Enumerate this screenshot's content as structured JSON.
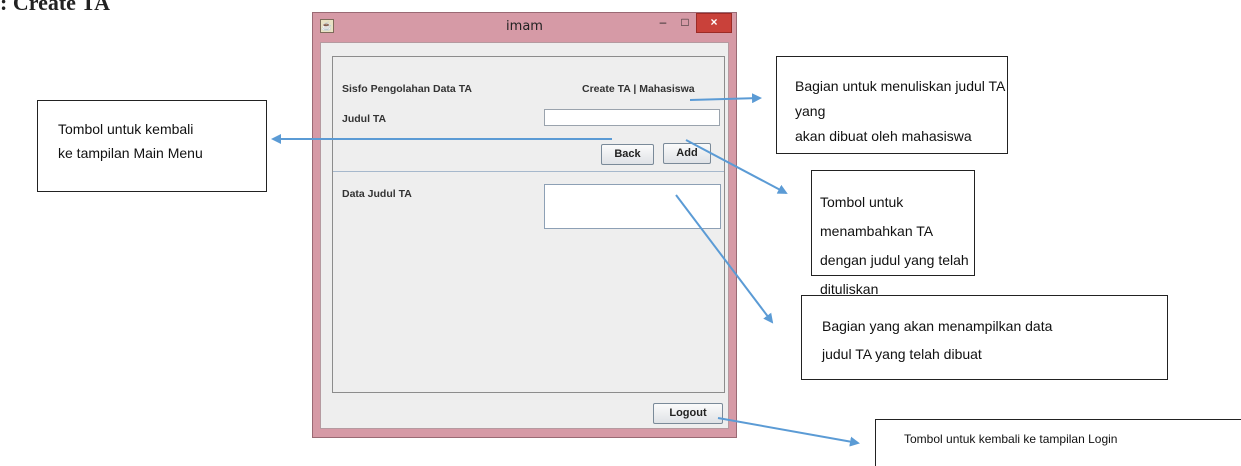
{
  "heading": ": Create TA",
  "window": {
    "title": "imam",
    "controls": {
      "minimize": "–",
      "maximize": "□",
      "close": "×"
    },
    "app_icon": "java-cup-icon"
  },
  "form": {
    "app_name": "Sisfo Pengolahan Data TA",
    "breadcrumb": "Create  TA | Mahasiswa",
    "judul_label": "Judul TA",
    "judul_value": "",
    "back_label": "Back",
    "add_label": "Add",
    "data_label": "Data Judul TA",
    "data_value": "",
    "logout_label": "Logout"
  },
  "annotations": {
    "back_note": [
      "Tombol untuk kembali",
      "ke tampilan Main Menu"
    ],
    "judul_note": [
      "Bagian untuk menuliskan judul TA yang",
      "akan dibuat oleh mahasiswa"
    ],
    "add_note": [
      "Tombol untuk menambahkan  TA",
      "dengan judul yang telah dituliskan"
    ],
    "data_note": [
      "Bagian yang akan menampilkan data",
      "judul TA yang telah dibuat"
    ],
    "logout_note": "Tombol untuk kembali ke tampilan Login"
  },
  "colors": {
    "arrow": "#5b9bd5",
    "window_frame": "#d69aa6",
    "close_button": "#c9413a"
  }
}
